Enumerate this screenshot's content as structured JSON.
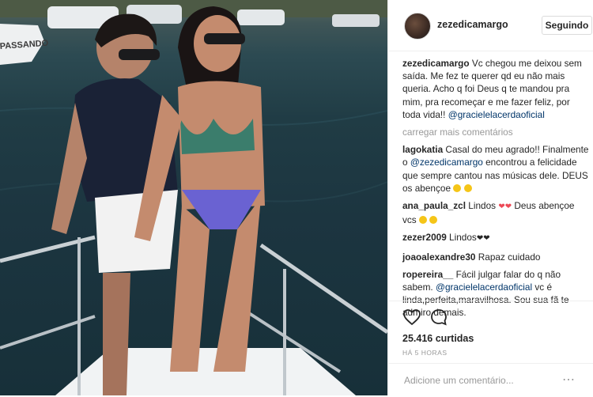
{
  "post": {
    "username": "zezedicamargo",
    "follow_label": "Seguindo",
    "likes": "25.416 curtidas",
    "time": "HÁ 5 HORAS",
    "add_comment_placeholder": "Adicione um comentário...",
    "more_comments": "carregar mais comentários"
  },
  "caption": {
    "user": "zezedicamargo",
    "text": "Vc chegou me deixou sem saída. Me fez te querer qd eu não mais queria. Acho q foi Deus q te mandou pra mim, pra recomeçar e me fazer feliz, por toda vida!!",
    "mention": "@gracielelacerdaoficial"
  },
  "comments": [
    {
      "user": "lagokatia",
      "text_a": "Casal do meu agrado!! Finalmente o",
      "mention": "@zezedicamargo",
      "text_b": "encontrou a felicidade que sempre cantou nas músicas dele. DEUS os abençoe"
    },
    {
      "user": "ana_paula_zcl",
      "text_a": "Lindos",
      "text_b": "Deus abençoe vcs"
    },
    {
      "user": "zezer2009",
      "text_a": "Lindos"
    },
    {
      "user": "joaoalexandre30",
      "text_a": "Rapaz cuidado"
    },
    {
      "user": "ropereira__",
      "text_a": "Fácil julgar falar do q não sabem.",
      "mention": "@gracielelacerdaoficial",
      "text_b": "vc é linda,perfeita,maravilhosa. Sou sua fã te admiro demais."
    }
  ],
  "boat_text": "PASSANDO",
  "icons": {
    "like": "heart-outline-icon",
    "comment": "comment-bubble-icon",
    "options": "more-options-icon"
  },
  "colors": {
    "link": "#003569",
    "muted": "#999999",
    "heart": "#ed4956"
  }
}
